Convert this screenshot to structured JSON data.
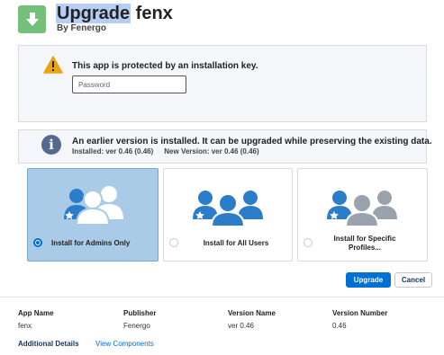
{
  "app": {
    "title_highlight": "Upgrade",
    "title_rest": " fenx",
    "publisher_line": "By Fenergo"
  },
  "key_panel": {
    "message": "This app is protected by an installation key.",
    "password_placeholder": "Password"
  },
  "version_panel": {
    "message": "An earlier version is installed. It can be upgraded while preserving the existing data.",
    "installed": "Installed: ver 0.46 (0.46)",
    "new_version": "New Version: ver 0.46 (0.46)"
  },
  "install_options": [
    {
      "label": "Install for Admins Only",
      "selected": true
    },
    {
      "label": "Install for All Users",
      "selected": false
    },
    {
      "label": "Install for Specific Profiles...",
      "selected": false
    }
  ],
  "buttons": {
    "upgrade": "Upgrade",
    "cancel": "Cancel"
  },
  "details": {
    "headers": [
      "App Name",
      "Publisher",
      "Version Name",
      "Version Number"
    ],
    "values": [
      "fenx",
      "Fenergo",
      "ver 0.46",
      "0.46"
    ]
  },
  "footer": {
    "additional_details": "Additional Details",
    "view_components": "View Components"
  },
  "colors": {
    "accent": "#0070d2",
    "selected_bg": "#a9cbe8",
    "logo_green": "#74c07a",
    "warning": "#e8a317",
    "user_blue": "#2c7dc9",
    "user_gray": "#9aa3ad"
  },
  "icons": [
    "download-arrow-icon",
    "warning-icon",
    "info-icon",
    "admins-users-icon",
    "all-users-icon",
    "specific-profiles-icon"
  ]
}
